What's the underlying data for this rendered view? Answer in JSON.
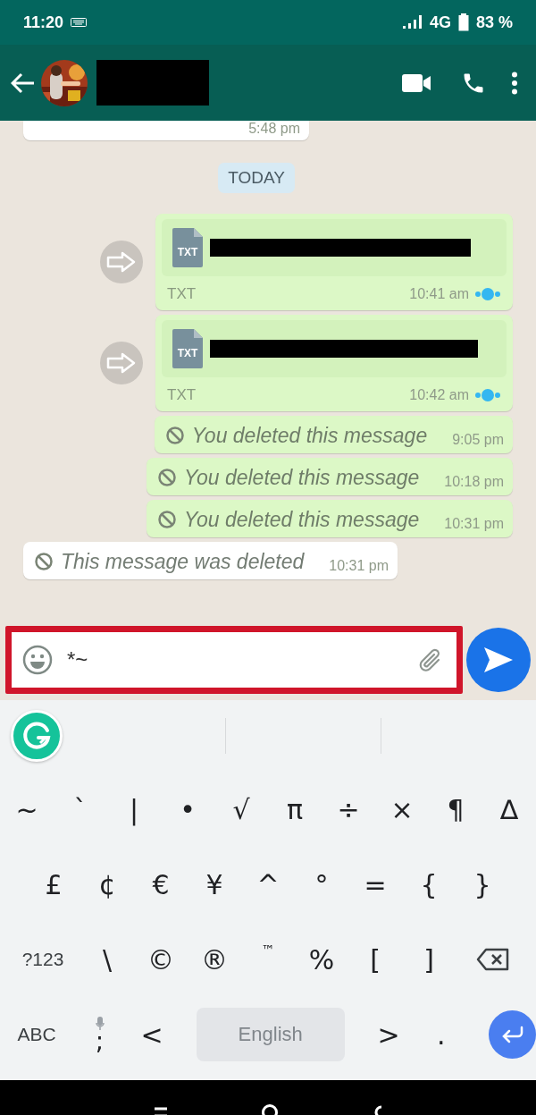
{
  "status_bar": {
    "time": "11:20",
    "network": "4G",
    "battery": "83 %"
  },
  "messages": [
    {
      "kind": "partial",
      "outgoing": false,
      "time": "5:48 pm"
    },
    {
      "kind": "date",
      "label": "TODAY"
    },
    {
      "kind": "file",
      "outgoing": true,
      "icon_label": "TXT",
      "type_label": "TXT",
      "time": "10:41 am"
    },
    {
      "kind": "file",
      "outgoing": true,
      "icon_label": "TXT",
      "type_label": "TXT",
      "time": "10:42 am"
    },
    {
      "kind": "deleted",
      "outgoing": true,
      "text": "You deleted this message",
      "time": "9:05 pm"
    },
    {
      "kind": "deleted",
      "outgoing": true,
      "text": "You deleted this message",
      "time": "10:18 pm"
    },
    {
      "kind": "deleted",
      "outgoing": true,
      "text": "You deleted this message",
      "time": "10:31 pm"
    },
    {
      "kind": "deleted",
      "outgoing": false,
      "text": "This message was deleted",
      "time": "10:31 pm"
    }
  ],
  "composer": {
    "value": "*~",
    "highlighted": true
  },
  "keyboard": {
    "symbol_rows": [
      [
        {
          "kind": "char",
          "label": "~"
        },
        {
          "kind": "char",
          "label": "`"
        },
        {
          "kind": "char",
          "label": "|"
        },
        {
          "kind": "char",
          "label": "•"
        },
        {
          "kind": "char",
          "label": "√"
        },
        {
          "kind": "char",
          "label": "π"
        },
        {
          "kind": "char",
          "label": "÷"
        },
        {
          "kind": "char",
          "label": "×"
        },
        {
          "kind": "char",
          "label": "¶"
        },
        {
          "kind": "char",
          "label": "∆"
        }
      ],
      [
        {
          "kind": "char",
          "label": "£"
        },
        {
          "kind": "char",
          "label": "¢"
        },
        {
          "kind": "char",
          "label": "€"
        },
        {
          "kind": "char",
          "label": "¥"
        },
        {
          "kind": "char",
          "label": "^"
        },
        {
          "kind": "char",
          "label": "°"
        },
        {
          "kind": "char",
          "label": "="
        },
        {
          "kind": "char",
          "label": "{"
        },
        {
          "kind": "char",
          "label": "}"
        }
      ],
      [
        {
          "kind": "mode",
          "label": "?123"
        },
        {
          "kind": "char",
          "label": "\\"
        },
        {
          "kind": "char",
          "label": "©"
        },
        {
          "kind": "char",
          "label": "®"
        },
        {
          "kind": "small",
          "label": "™"
        },
        {
          "kind": "char",
          "label": "%"
        },
        {
          "kind": "char",
          "label": "["
        },
        {
          "kind": "char",
          "label": "]"
        },
        {
          "kind": "backspace"
        }
      ]
    ],
    "bottom_row": [
      {
        "kind": "mode",
        "label": "ABC"
      },
      {
        "kind": "mic",
        "label": ";"
      },
      {
        "kind": "char",
        "label": "<"
      },
      {
        "kind": "space",
        "label": "English"
      },
      {
        "kind": "char",
        "label": ">"
      },
      {
        "kind": "char",
        "label": "."
      },
      {
        "kind": "enter"
      }
    ]
  }
}
